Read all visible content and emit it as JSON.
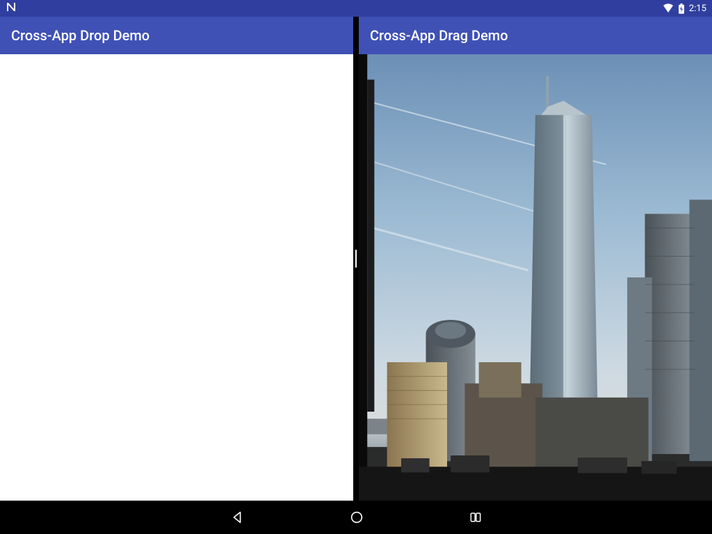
{
  "status": {
    "time": "2:15",
    "wifi_icon": "wifi-icon",
    "battery_icon": "battery-charging-icon",
    "n_icon": "android-n-icon"
  },
  "left_app": {
    "title": "Cross-App Drop Demo"
  },
  "right_app": {
    "title": "Cross-App Drag Demo",
    "image_description": "city-skyline-photo"
  },
  "nav": {
    "back": "back",
    "home": "home",
    "recents": "recents"
  },
  "colors": {
    "status_bar": "#303F9F",
    "app_bar": "#3F51B5",
    "divider": "#000000"
  }
}
